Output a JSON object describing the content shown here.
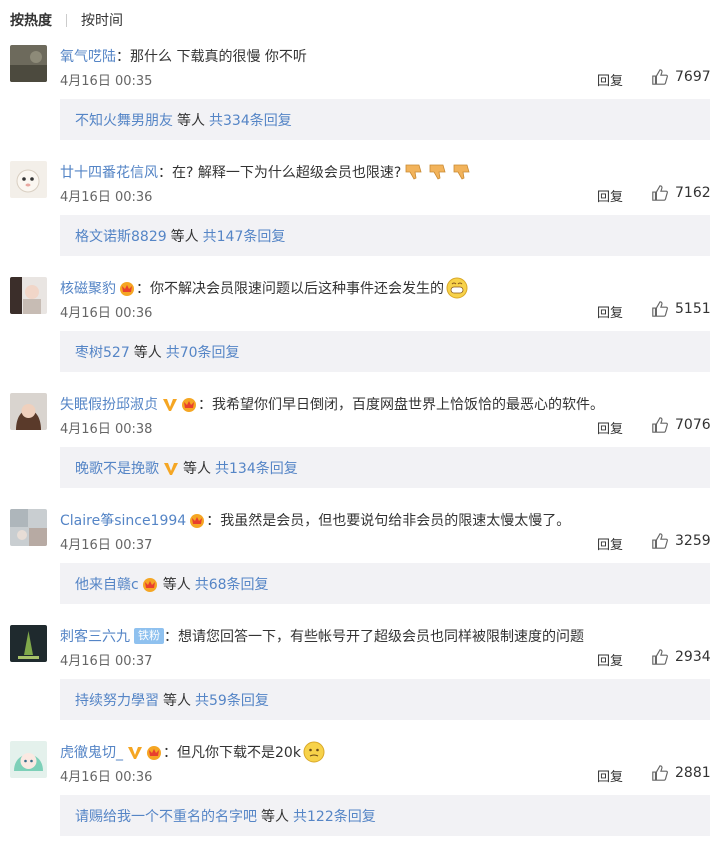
{
  "sort": {
    "hot": "按热度",
    "time": "按时间"
  },
  "comments": [
    {
      "user": "氧气呓陆",
      "text": "那什么 下载真的很慢 你不听",
      "date": "4月16日 00:35",
      "reply": "回复",
      "likes": "7697",
      "sub": {
        "user": "不知火舞男朋友",
        "mid": "等人",
        "count": "共334条回复"
      }
    },
    {
      "user": "廿十四番花信风",
      "text": "在? 解释一下为什么超级会员也限速?",
      "date": "4月16日 00:36",
      "reply": "回复",
      "likes": "7162",
      "sub": {
        "user": "格文诺斯8829",
        "mid": "等人",
        "count": "共147条回复"
      }
    },
    {
      "user": "核磁聚豹",
      "text": "你不解决会员限速问题以后这种事件还会发生的",
      "date": "4月16日 00:36",
      "reply": "回复",
      "likes": "5151",
      "sub": {
        "user": "枣树527",
        "mid": "等人",
        "count": "共70条回复"
      }
    },
    {
      "user": "失眠假扮邱淑贞",
      "text": "我希望你们早日倒闭，百度网盘世界上恰饭恰的最恶心的软件。",
      "date": "4月16日 00:38",
      "reply": "回复",
      "likes": "7076",
      "sub": {
        "user": "晚歌不是挽歌",
        "mid": "等人",
        "count": "共134条回复"
      }
    },
    {
      "user": "Claire筝since1994",
      "text": "我虽然是会员，但也要说句给非会员的限速太慢太慢了。",
      "date": "4月16日 00:37",
      "reply": "回复",
      "likes": "3259",
      "sub": {
        "user": "他来自赣c",
        "mid": "等人",
        "count": "共68条回复"
      }
    },
    {
      "user": "刺客三六九",
      "badge": "铁粉",
      "text": "想请您回答一下，有些帐号开了超级会员也同样被限制速度的问题",
      "date": "4月16日 00:37",
      "reply": "回复",
      "likes": "2934",
      "sub": {
        "user": "持续努力學習",
        "mid": "等人",
        "count": "共59条回复"
      }
    },
    {
      "user": "虎徹鬼切_",
      "text": "但凡你下载不是20k",
      "date": "4月16日 00:36",
      "reply": "回复",
      "likes": "2881",
      "sub": {
        "user": "请赐给我一个不重名的名字吧",
        "mid": "等人",
        "count": "共122条回复"
      }
    }
  ],
  "colors": {
    "link": "#5585c6",
    "subreply_bg": "#f2f2f5",
    "fan_badge": "#8fc1ef"
  }
}
